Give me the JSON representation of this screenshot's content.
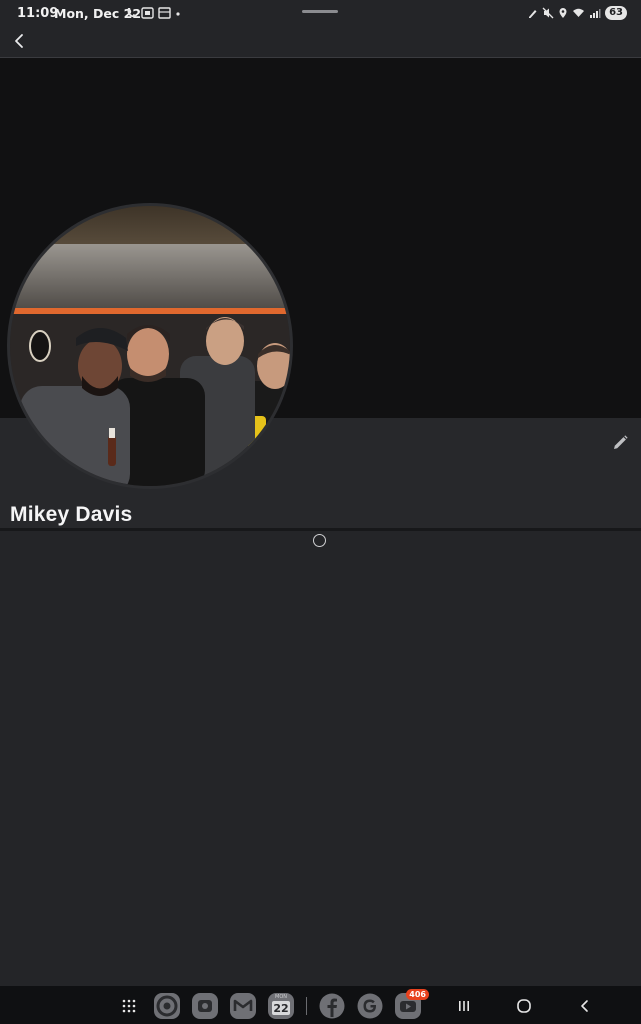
{
  "status_bar": {
    "time": "11:09",
    "date": "Mon, Dec 22",
    "battery": "63"
  },
  "app_bar": {
    "back_icon": "chevron-left-icon"
  },
  "profile": {
    "name": "Mikey Davis",
    "edit_icon": "pencil-icon",
    "avatar": "group-photo-four-men"
  },
  "content": {
    "loading": "spinner"
  },
  "nav_bar": {
    "apps": [
      {
        "name": "app-drawer"
      },
      {
        "name": "chrome"
      },
      {
        "name": "camera"
      },
      {
        "name": "gmail"
      },
      {
        "name": "calendar",
        "month": "MON",
        "day": "22"
      },
      {
        "name": "facebook"
      },
      {
        "name": "google"
      },
      {
        "name": "youtube",
        "badge": "406"
      }
    ]
  },
  "colors": {
    "background": "#242528",
    "cover": "#111112",
    "profile_section": "#27282b",
    "nav_bar": "#0f1012",
    "badge": "#e8421e",
    "text": "#f5f5f6"
  }
}
